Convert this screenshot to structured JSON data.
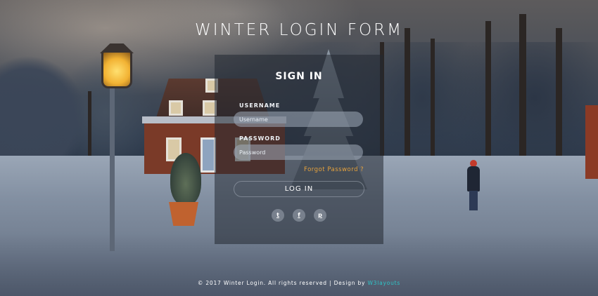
{
  "page": {
    "title": "WINTER LOGIN FORM"
  },
  "form": {
    "heading": "SIGN IN",
    "username_label": "USERNAME",
    "username_placeholder": "Username",
    "username_value": "",
    "password_label": "PASSWORD",
    "password_placeholder": "Password",
    "password_value": "",
    "forgot_link": "Forgot Password ?",
    "login_button": "LOG IN"
  },
  "social": [
    {
      "icon": "twitter-icon",
      "glyph": "t"
    },
    {
      "icon": "facebook-icon",
      "glyph": "f"
    },
    {
      "icon": "pinterest-icon",
      "glyph": "p"
    }
  ],
  "footer": {
    "text": "© 2017 Winter Login. All rights reserved | Design by ",
    "link": "W3layouts"
  },
  "colors": {
    "accent_link": "#e6a23c",
    "footer_link": "#2ec4c7"
  }
}
